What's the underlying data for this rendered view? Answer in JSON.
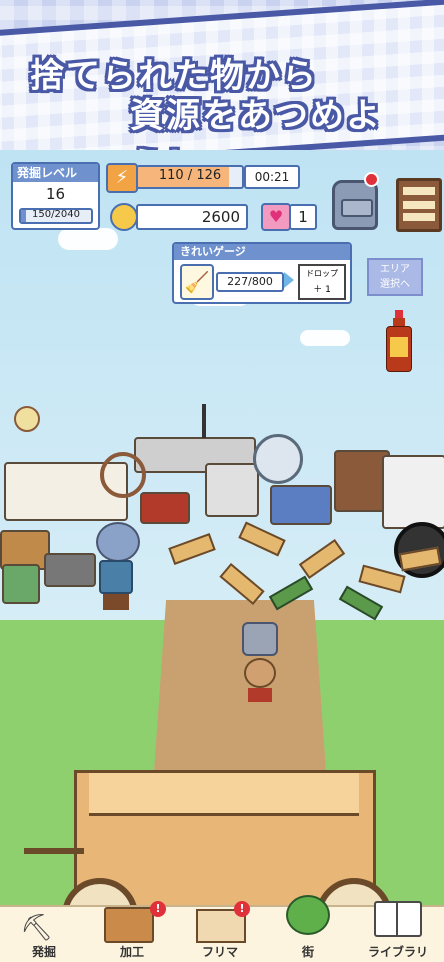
{
  "banner": {
    "line1": "捨てられた物から",
    "line2": "資源をあつめよう！"
  },
  "level": {
    "header": "発掘レベル",
    "value": "16",
    "progress": "150/2040",
    "progress_ratio": 0.0735
  },
  "energy": {
    "value": "110 / 126",
    "timer": "00:21",
    "ratio": 0.873
  },
  "coins": {
    "value": "2600"
  },
  "hearts": {
    "value": "1"
  },
  "clean_gauge": {
    "header": "きれいゲージ",
    "value": "227/800",
    "drop_label": "ドロップ",
    "drop_value": "＋ 1"
  },
  "area_button": {
    "line1": "エリア",
    "line2": "選択へ"
  },
  "nav": {
    "items": [
      {
        "label": "発掘",
        "icon": "shovel-icon",
        "badge": false
      },
      {
        "label": "加工",
        "icon": "workbench-icon",
        "badge": true
      },
      {
        "label": "フリマ",
        "icon": "flea-market-icon",
        "badge": true
      },
      {
        "label": "街",
        "icon": "town-icon",
        "badge": false
      },
      {
        "label": "ライブラリ",
        "icon": "book-icon",
        "badge": false
      }
    ]
  },
  "colors": {
    "accent": "#4a59a6",
    "panel_border": "#4a6fb0",
    "badge": "#e0303a",
    "grass": "#8fd06e",
    "path": "#c9a06f"
  }
}
